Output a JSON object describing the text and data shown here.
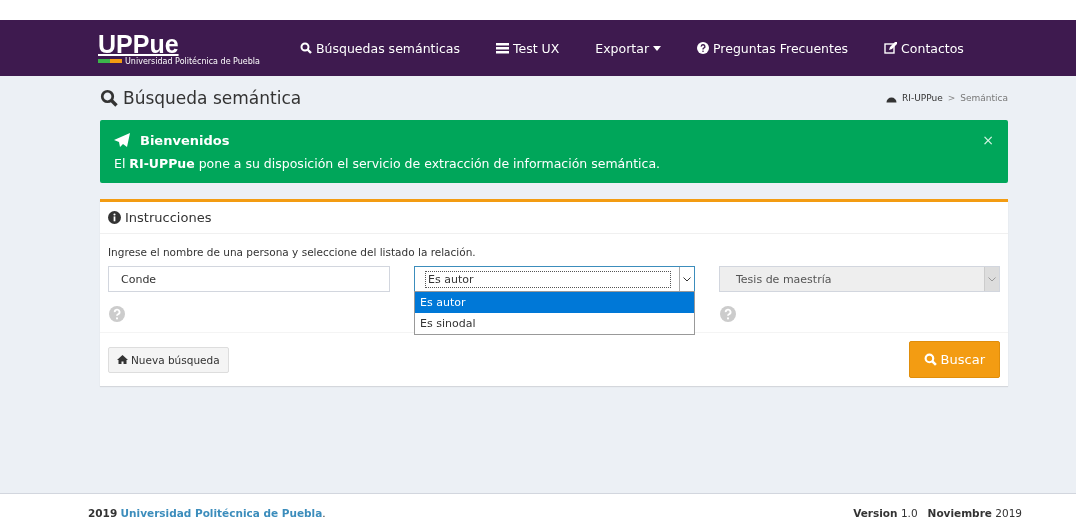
{
  "navbar": {
    "logo": "UPPue",
    "logo_subtitle": "Universidad Politécnica de Puebla",
    "items": [
      {
        "label": "Búsquedas semánticas",
        "kind": "search"
      },
      {
        "label": "Test UX",
        "kind": "list"
      },
      {
        "label": "Exportar",
        "kind": "dropdown"
      },
      {
        "label": "Preguntas Frecuentes",
        "kind": "question"
      },
      {
        "label": "Contactos",
        "kind": "edit"
      }
    ]
  },
  "page_title": "Búsqueda semántica",
  "breadcrumb": [
    "RI-UPPue",
    ">",
    "Semántica"
  ],
  "alert": {
    "title": "Bienvenidos",
    "text": "El **RI-UPPue** pone a su disposición el servicio de extracción de información semántica.",
    "close": "×"
  },
  "panel": {
    "title": "Instrucciones",
    "hint": "Ingrese el nombre de una persona y seleccione del listado la relación.",
    "name_field": {
      "value": "Conde"
    },
    "relation_select": {
      "value": "Es autor",
      "expanded": true,
      "options": [
        {
          "label": "Es autor",
          "selected": true
        },
        {
          "label": "Es sinodal",
          "selected": false
        }
      ]
    },
    "type_select": {
      "value": "Tesis de maestría",
      "disabled": true
    },
    "reset_button": "Nueva búsqueda",
    "search_button": "Buscar"
  },
  "footer": {
    "left": "**2019** ",
    "link": "Universidad Politécnica de Puebla",
    "left_end": ".",
    "right": "**Version** 1.0   **Noviembre** 2019"
  }
}
